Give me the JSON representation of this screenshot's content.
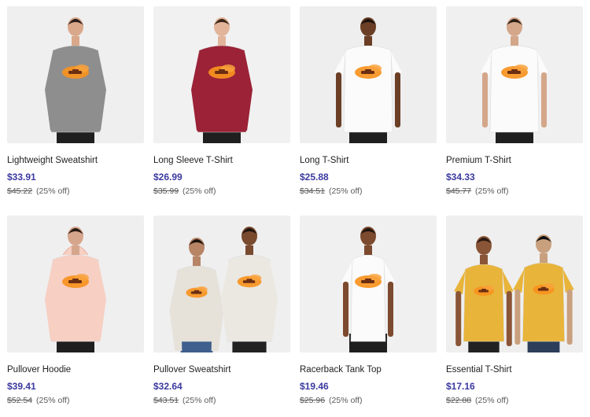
{
  "products": [
    {
      "title": "Lightweight Sweatshirt",
      "price": "$33.91",
      "old_price": "$45.22",
      "discount": "(25% off)",
      "garment": "#8e8e8e",
      "skin": "#d9a88a",
      "hair": "#2a201a",
      "bg": "#efefef",
      "fit": "sweater"
    },
    {
      "title": "Long Sleeve T-Shirt",
      "price": "$26.99",
      "old_price": "$35.99",
      "discount": "(25% off)",
      "garment": "#9b2237",
      "skin": "#e2b49a",
      "hair": "#3a2618",
      "bg": "#f1f1f1",
      "fit": "longsleeve"
    },
    {
      "title": "Long T-Shirt",
      "price": "$25.88",
      "old_price": "$34.51",
      "discount": "(25% off)",
      "garment": "#fbfbfb",
      "skin": "#6b3f26",
      "hair": "#1b120c",
      "bg": "#eeeeee",
      "fit": "tee"
    },
    {
      "title": "Premium T-Shirt",
      "price": "$34.33",
      "old_price": "$45.77",
      "discount": "(25% off)",
      "garment": "#fbfbfb",
      "skin": "#d4a68a",
      "hair": "#2b1e16",
      "bg": "#f0f0f0",
      "fit": "tee"
    },
    {
      "title": "Pullover Hoodie",
      "price": "$39.41",
      "old_price": "$52.54",
      "discount": "(25% off)",
      "garment": "#f7cfc3",
      "skin": "#d6a68c",
      "hair": "#2a1d15",
      "bg": "#efefef",
      "fit": "hoodie"
    },
    {
      "title": "Pullover Sweatshirt",
      "price": "$32.64",
      "old_price": "$43.51",
      "discount": "(25% off)",
      "garment": "#e7e3db",
      "skin": "#7a4a2e",
      "hair": "#1d140f",
      "bg": "#efefef",
      "fit": "duo"
    },
    {
      "title": "Racerback Tank Top",
      "price": "$19.46",
      "old_price": "$25.96",
      "discount": "(25% off)",
      "garment": "#fbfbfb",
      "skin": "#7c4a2e",
      "hair": "#1e140f",
      "bg": "#f0f0f0",
      "fit": "tank"
    },
    {
      "title": "Essential T-Shirt",
      "price": "$17.16",
      "old_price": "$22.88",
      "discount": "(25% off)",
      "garment": "#e8b43a",
      "skin": "#8a5536",
      "hair": "#241812",
      "bg": "#efefef",
      "fit": "duo-tee"
    }
  ],
  "accent": "#3b3aa0",
  "design_colors": {
    "splash": "#f7931e",
    "car": "#6b2e12"
  }
}
